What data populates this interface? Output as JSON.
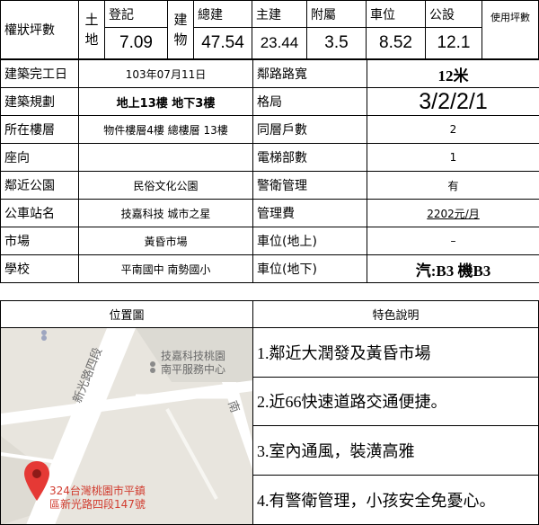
{
  "area": {
    "label": "權狀坪數",
    "land_chars": [
      "土",
      "地"
    ],
    "registered_label": "登記",
    "registered_value": "7.09",
    "building_chars": [
      "建",
      "物"
    ],
    "total_label": "總建",
    "total_value": "47.54",
    "main_label": "主建",
    "main_value": "23.44",
    "annex_label": "附屬",
    "annex_value": "3.5",
    "parking_label": "車位",
    "parking_value": "8.52",
    "public_label": "公設",
    "public_value": "12.1",
    "usage_label": "使用坪數",
    "usage_value": ""
  },
  "rows": [
    {
      "k1": "建築完工日",
      "v1": "103年07月11日",
      "k2": "鄰路路寬",
      "v2": "12米"
    },
    {
      "k1": "建築規劃",
      "v1": "地上13樓 地下3樓",
      "k2": "格局",
      "v2": "3/2/2/1"
    },
    {
      "k1": "所在樓層",
      "v1": "物件樓層4樓 總樓層 13樓",
      "k2": "同層戶數",
      "v2": "2"
    },
    {
      "k1": "座向",
      "v1": "",
      "k2": "電梯部數",
      "v2": "1"
    },
    {
      "k1": "鄰近公園",
      "v1": "民俗文化公園",
      "k2": "警衛管理",
      "v2": "有"
    },
    {
      "k1": "公車站名",
      "v1": "技嘉科技 城市之星",
      "k2": "管理費",
      "v2": "2202元/月"
    },
    {
      "k1": "市場",
      "v1": "黃昏市場",
      "k2": "車位(地上)",
      "v2": "–"
    },
    {
      "k1": "學校",
      "v1": "平南國中 南勢國小",
      "k2": "車位(地下)",
      "v2": "汽:B3 機B3"
    }
  ],
  "map": {
    "header": "位置圖",
    "poi_line1": "技嘉科技桃園",
    "poi_line2": "南平服務中心",
    "road_label": "新光路四段",
    "road_label2": "南",
    "address_line1": "324台灣桃園市平鎮",
    "address_line2": "區新光路四段147號"
  },
  "features": {
    "header": "特色說明",
    "items": [
      "1.鄰近大潤發及黃昏市場",
      "2.近66快速道路交通便捷。",
      "3.室內通風，裝潢高雅",
      "4.有警衛管理，小孩安全免憂心。"
    ]
  }
}
